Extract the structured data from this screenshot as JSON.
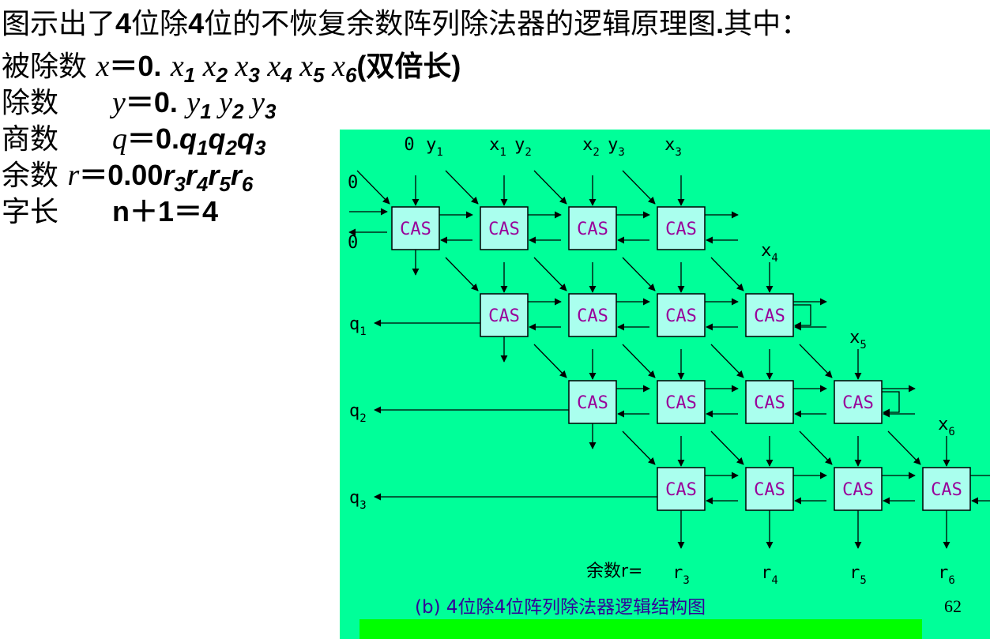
{
  "title": {
    "part1": "图示出了",
    "part2": "4",
    "part3": "位除",
    "part4": "4",
    "part5": "位的不恢复余数阵列除法器的逻辑原理图",
    "part6": ".",
    "part7": "其中："
  },
  "definitions": {
    "dividend": {
      "label": "被除数",
      "symbol": "x",
      "eq": "＝",
      "val": "0.",
      "note": "(双倍长)"
    },
    "divisor": {
      "label": "除数",
      "symbol": "y",
      "eq": "＝",
      "val": "0."
    },
    "quotient": {
      "label": "商数",
      "symbol": "q",
      "eq": "＝",
      "val": "0."
    },
    "remainder": {
      "label": "余数",
      "symbol": "r",
      "eq": "＝",
      "val": "0.00"
    },
    "wordlen": {
      "label": "字长",
      "expr": "n＋1＝4"
    }
  },
  "diagram": {
    "background": "#00ff99",
    "bottom_bar_color": "#00ff00",
    "cell_fill": "#aaffee",
    "cell_text_color": "#990099",
    "caption_color": "#330099",
    "cell_label": "CAS",
    "rows": [
      {
        "offset": 0,
        "output": "q0_row"
      },
      {
        "offset": 1,
        "output": "q1"
      },
      {
        "offset": 2,
        "output": "q2"
      },
      {
        "offset": 3,
        "output": "q3"
      }
    ],
    "top_inputs": [
      "0",
      "y1",
      "x1",
      "y2",
      "x2",
      "y3",
      "x3"
    ],
    "side_inputs": [
      "x4",
      "x5",
      "x6"
    ],
    "left_zero_top": "0",
    "left_zero_bottom": "0",
    "quotient_labels": [
      "q1",
      "q2",
      "q3"
    ],
    "remainder_prefix": "余数r=",
    "remainder_labels": [
      "r3",
      "r4",
      "r5",
      "r6"
    ],
    "caption": "(b)  4位除4位阵列除法器逻辑结构图"
  },
  "page_number": "62"
}
